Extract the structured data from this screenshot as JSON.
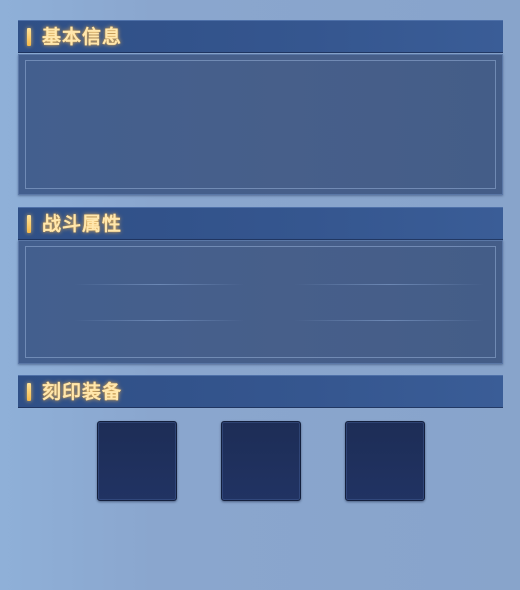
{
  "sections": {
    "basic_info": {
      "title": "基本信息"
    },
    "battle_stats": {
      "title": "战斗属性"
    },
    "engraved_equipment": {
      "title": "刻印装备"
    }
  },
  "colors": {
    "header_bg": "#35568f",
    "header_text": "#ffe7ad",
    "accent_bar": "#f5b94a",
    "panel_bg": "#455e8b",
    "slot_bg": "#1f3060",
    "page_bg": "#8aa6ce"
  },
  "equipment_slots": [
    {
      "name": "equip-slot-1"
    },
    {
      "name": "equip-slot-2"
    },
    {
      "name": "equip-slot-3"
    }
  ]
}
